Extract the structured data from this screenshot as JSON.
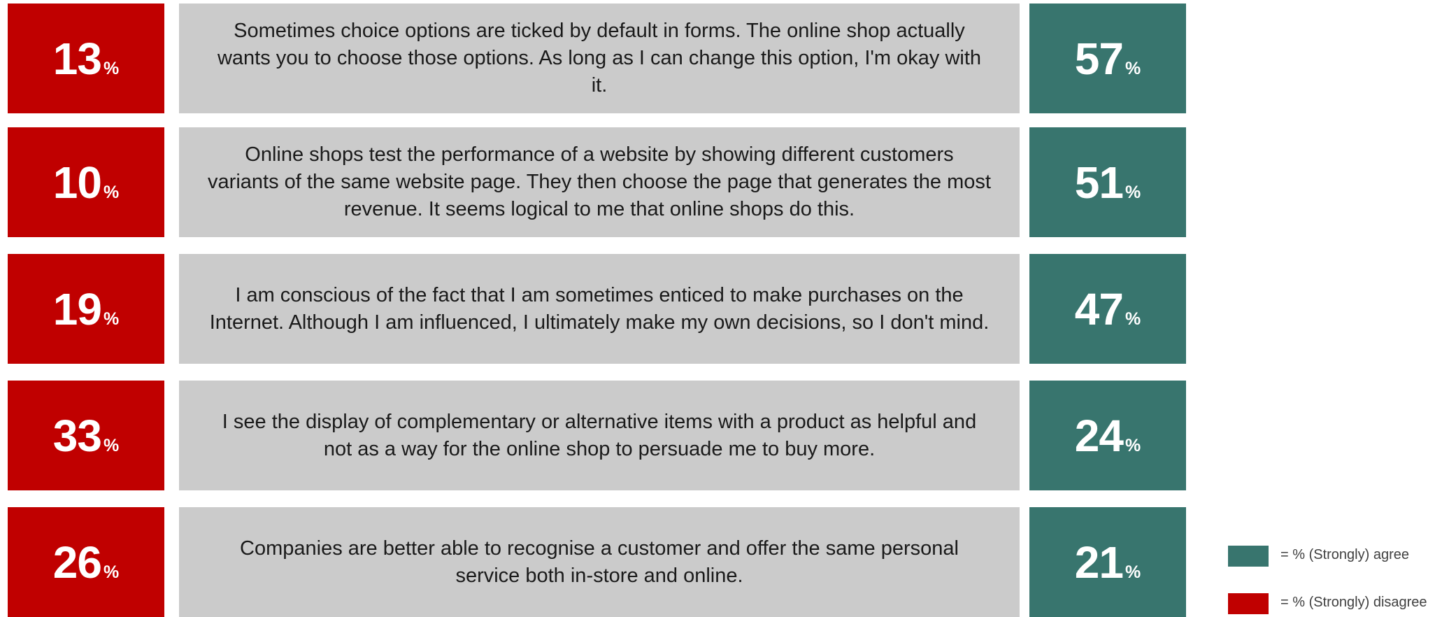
{
  "chart_data": {
    "type": "table",
    "columns": [
      "% (Strongly) disagree",
      "Statement",
      "% (Strongly) agree"
    ],
    "rows": [
      {
        "disagree": 13,
        "statement": "Sometimes choice options are ticked by default in forms. The online shop actually wants you to choose those options. As long as I can change this option, I'm okay with it.",
        "agree": 57
      },
      {
        "disagree": 10,
        "statement": "Online shops test the performance of a website by showing different customers variants of the same website page. They then choose the page that generates the most revenue. It seems logical to me that online shops do this.",
        "agree": 51
      },
      {
        "disagree": 19,
        "statement": "I am conscious of the fact that I am sometimes enticed to make purchases on the Internet. Although I am influenced, I ultimately make my own decisions, so I don't mind.",
        "agree": 47
      },
      {
        "disagree": 33,
        "statement": "I see the display of complementary or alternative items with a product as helpful and not as a way for the online shop to persuade me to buy more.",
        "agree": 24
      },
      {
        "disagree": 26,
        "statement": "Companies are better able to recognise a customer and offer the same personal service both in-store and online.",
        "agree": 21
      }
    ],
    "percent_sign": "%",
    "legend": [
      {
        "label": "= % (Strongly) agree",
        "color": "#38756e"
      },
      {
        "label": "= % (Strongly) disagree",
        "color": "#c00000"
      }
    ],
    "legend_position": "bottom-right"
  },
  "colors": {
    "disagree": "#c00000",
    "agree": "#38756e",
    "statement_bg": "#cbcbcb"
  }
}
